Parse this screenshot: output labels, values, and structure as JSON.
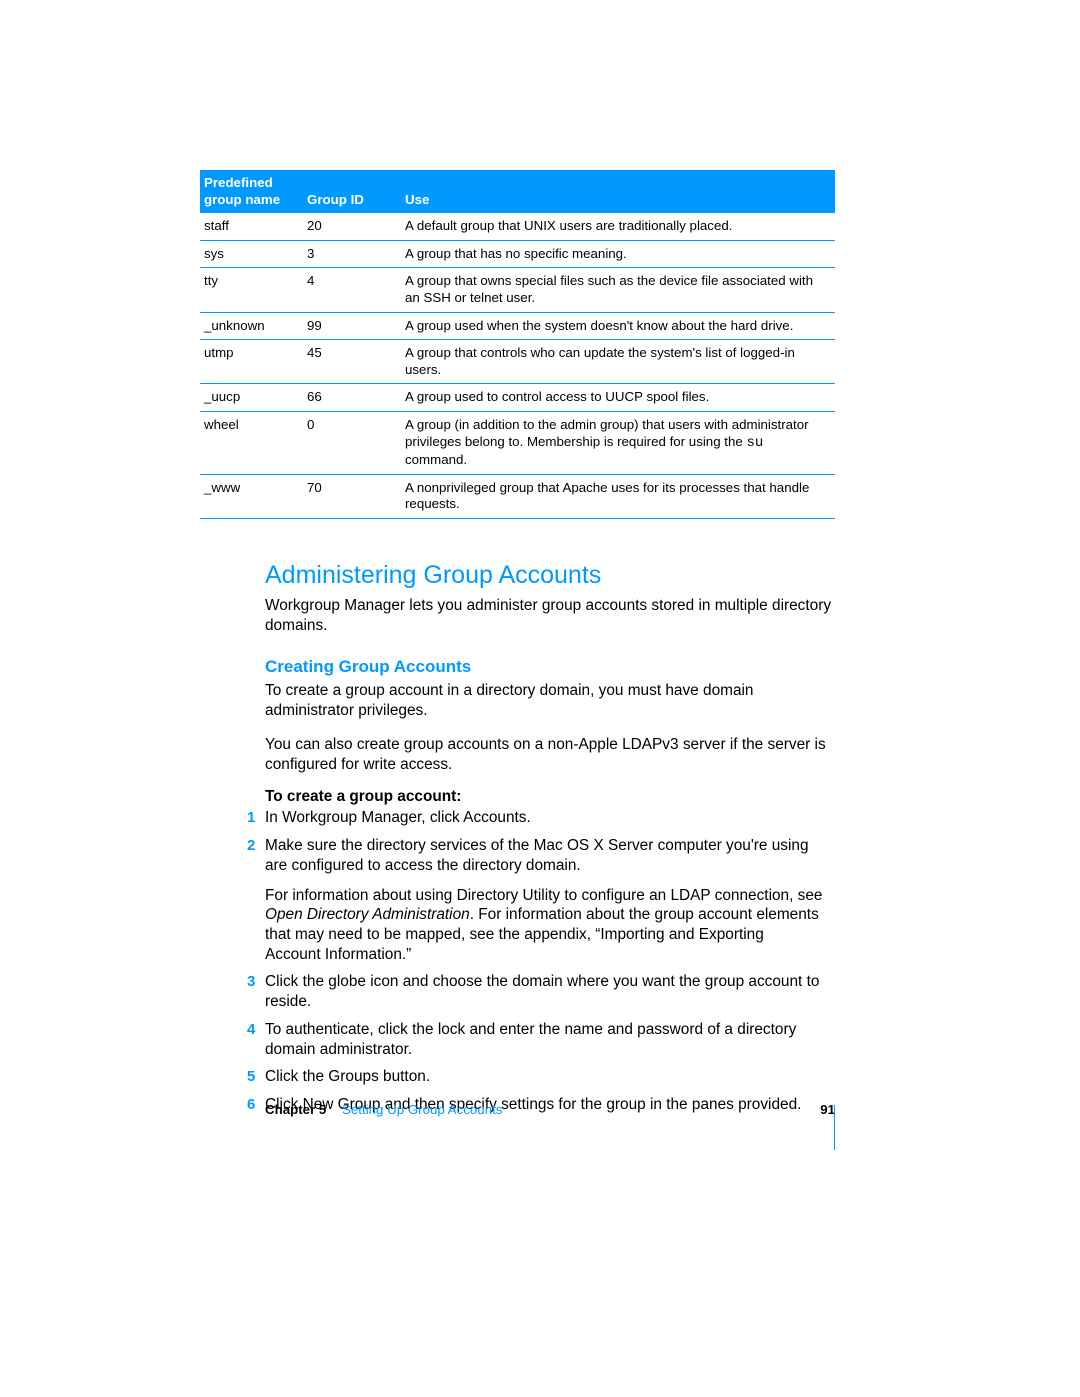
{
  "table": {
    "headers": {
      "name": "Predefined group name",
      "id": "Group ID",
      "use": "Use"
    },
    "rows": [
      {
        "name": "staff",
        "id": "20",
        "use": "A default group that UNIX users are traditionally placed."
      },
      {
        "name": "sys",
        "id": "3",
        "use": "A group that has no specific meaning."
      },
      {
        "name": "tty",
        "id": "4",
        "use": "A group that owns special files such as the device file associated with an SSH or telnet user."
      },
      {
        "name": "_unknown",
        "id": "99",
        "use": "A group used when the system doesn't know about the hard drive."
      },
      {
        "name": "utmp",
        "id": "45",
        "use": "A group that controls who can update the system's list of logged-in users."
      },
      {
        "name": "_uucp",
        "id": "66",
        "use": "A group used to control access to UUCP spool files."
      },
      {
        "name": "wheel",
        "id": "0",
        "use_pre": "A group (in addition to the admin group) that users with administrator privileges belong to. Membership is required for using the ",
        "use_cmd": "su",
        "use_post": " command."
      },
      {
        "name": "_www",
        "id": "70",
        "use": "A nonprivileged group that Apache uses for its processes that handle requests."
      }
    ]
  },
  "h1": "Administering Group Accounts",
  "p1": "Workgroup Manager lets you administer group accounts stored in multiple directory domains.",
  "h2": "Creating Group Accounts",
  "p2": "To create a group account in a directory domain, you must have domain administrator privileges.",
  "p3": "You can also create group accounts on a non-Apple LDAPv3 server if the server is configured for write access.",
  "steps_title": "To create a group account:",
  "steps": [
    {
      "text": "In Workgroup Manager, click Accounts."
    },
    {
      "text": "Make sure the directory services of the Mac OS X Server computer you're using are configured to access the directory domain.",
      "extra_pre": "For information about using Directory Utility to configure an LDAP connection, see ",
      "extra_ital": "Open Directory Administration",
      "extra_post": ". For information about the group account elements that may need to be mapped, see the appendix, “Importing and Exporting Account Information.”"
    },
    {
      "text": "Click the globe icon and choose the domain where you want the group account to reside."
    },
    {
      "text": "To authenticate, click the lock and enter the name and password of a directory domain administrator."
    },
    {
      "text": "Click the Groups button."
    },
    {
      "text": "Click New Group and then specify settings for the group in the panes provided."
    }
  ],
  "footer": {
    "chapter_label": "Chapter 5",
    "chapter_title": "Setting Up Group Accounts",
    "page_number": "91"
  }
}
